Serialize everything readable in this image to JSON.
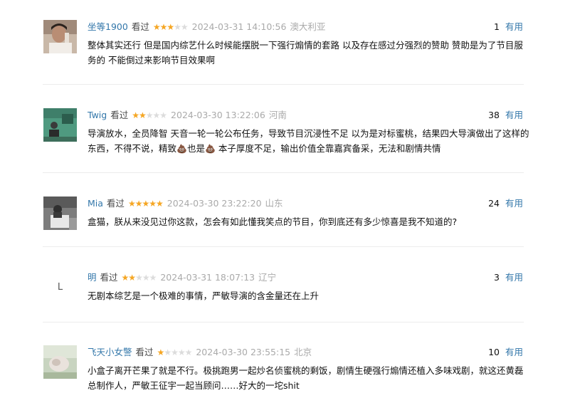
{
  "watched_label": "看过",
  "helpful_label": "有用",
  "colors": {
    "link": "#3377aa",
    "star_on": "#f5a623",
    "star_off": "#dcdcdc",
    "muted": "#aaaaaa"
  },
  "comments": [
    {
      "user": "坐等1900",
      "rating": 3,
      "time": "2024-03-31 14:10:56",
      "location": "澳大利亚",
      "votes": "1",
      "text": "整体其实还行 但是国内综艺什么时候能摆脱一下强行煽情的套路 以及存在感过分强烈的赞助 赞助是为了节目服务的 不能倒过来影响节目效果啊",
      "avatar": "photo-man"
    },
    {
      "user": "Twig",
      "rating": 2,
      "time": "2024-03-30 13:22:06",
      "location": "河南",
      "votes": "38",
      "text_part1": "导演放水，全员降智 天音一轮一轮公布任务，导致节目沉浸性不足 以为是对标蜜桃，结果四大导演做出了这样的东西，不得不说，精致",
      "text_part2": "也是",
      "text_part3": " 本子厚度不足，输出价值全靠嘉宾备采，无法和剧情共情",
      "emoji": "poop-icon",
      "avatar": "photo-green"
    },
    {
      "user": "Mia",
      "rating": 5,
      "time": "2024-03-30 23:22:20",
      "location": "山东",
      "votes": "24",
      "text": "盒猫，朕从来没见过你这款，怎会有如此懂我笑点的节目，你到底还有多少惊喜是我不知道的?",
      "avatar": "photo-reading"
    },
    {
      "user": "明",
      "rating": 2,
      "time": "2024-03-31 18:07:13",
      "location": "辽宁",
      "votes": "3",
      "text": "无剧本综艺是一个极难的事情，严敏导演的含金量还在上升",
      "avatar_letter": "L"
    },
    {
      "user": "飞天小女警",
      "rating": 1,
      "time": "2024-03-30 23:55:15",
      "location": "北京",
      "votes": "10",
      "text": "小盒子离开芒果了就是不行。极挑跑男一起炒名侦蜜桃的剩饭，剧情生硬强行煽情还植入多味戏剧，就这还黄磊总制作人，严敏王征宇一起当顾问……好大的一坨shit",
      "avatar": "photo-pastel"
    }
  ]
}
